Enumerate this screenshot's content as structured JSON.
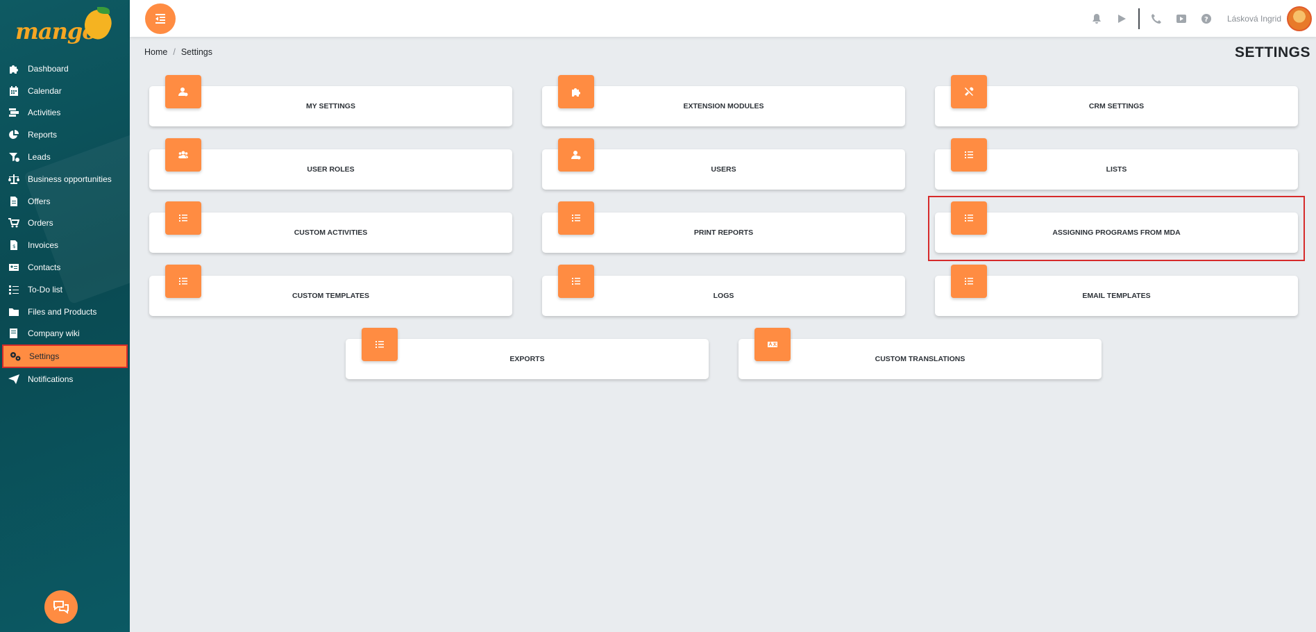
{
  "app": {
    "logo_text": "mango"
  },
  "sidebar": {
    "items": [
      {
        "label": "Dashboard",
        "icon": "puzzle-icon"
      },
      {
        "label": "Calendar",
        "icon": "calendar-icon"
      },
      {
        "label": "Activities",
        "icon": "activities-icon"
      },
      {
        "label": "Reports",
        "icon": "pie-chart-icon"
      },
      {
        "label": "Leads",
        "icon": "funnel-icon"
      },
      {
        "label": "Business opportunities",
        "icon": "scale-icon"
      },
      {
        "label": "Offers",
        "icon": "document-icon"
      },
      {
        "label": "Orders",
        "icon": "cart-icon"
      },
      {
        "label": "Invoices",
        "icon": "invoice-icon"
      },
      {
        "label": "Contacts",
        "icon": "contact-card-icon"
      },
      {
        "label": "To-Do list",
        "icon": "checklist-icon"
      },
      {
        "label": "Files and Products",
        "icon": "folder-icon"
      },
      {
        "label": "Company wiki",
        "icon": "book-icon"
      },
      {
        "label": "Settings",
        "icon": "gears-icon",
        "active": true
      },
      {
        "label": "Notifications",
        "icon": "paper-plane-icon"
      }
    ]
  },
  "topbar": {
    "user_name": "Lásková Ingrid",
    "icons": [
      "bell-icon",
      "play-icon",
      "phone-icon",
      "youtube-icon",
      "help-icon"
    ]
  },
  "breadcrumb": {
    "home": "Home",
    "current": "Settings"
  },
  "page": {
    "title": "SETTINGS"
  },
  "cards": [
    {
      "label": "MY SETTINGS",
      "icon": "user-cog-icon"
    },
    {
      "label": "EXTENSION MODULES",
      "icon": "puzzle-icon"
    },
    {
      "label": "CRM SETTINGS",
      "icon": "tools-icon"
    },
    {
      "label": "USER ROLES",
      "icon": "users-icon"
    },
    {
      "label": "USERS",
      "icon": "user-cog-icon"
    },
    {
      "label": "LISTS",
      "icon": "list-icon"
    },
    {
      "label": "CUSTOM ACTIVITIES",
      "icon": "list-icon"
    },
    {
      "label": "PRINT REPORTS",
      "icon": "list-icon"
    },
    {
      "label": "ASSIGNING PROGRAMS FROM MDA",
      "icon": "list-icon",
      "highlighted": true
    },
    {
      "label": "CUSTOM TEMPLATES",
      "icon": "list-icon"
    },
    {
      "label": "LOGS",
      "icon": "list-icon"
    },
    {
      "label": "EMAIL TEMPLATES",
      "icon": "list-icon"
    },
    {
      "label": "EXPORTS",
      "icon": "list-icon"
    },
    {
      "label": "CUSTOM TRANSLATIONS",
      "icon": "language-icon"
    }
  ],
  "colors": {
    "accent": "#ff8c42",
    "sidebar": "#0e5a63",
    "highlight": "#d62a2a",
    "background": "#e9ecef"
  }
}
